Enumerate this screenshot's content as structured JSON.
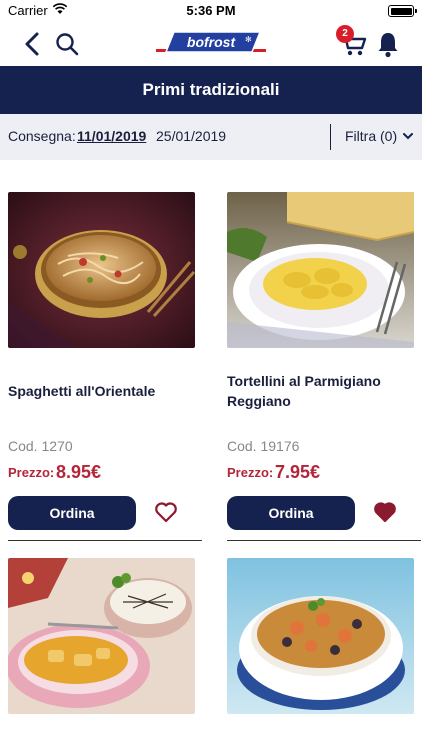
{
  "status_bar": {
    "carrier": "Carrier",
    "time": "5:36 PM"
  },
  "header": {
    "logo_text": "bofrost",
    "cart_count": "2"
  },
  "page_title": "Primi tradizionali",
  "delivery": {
    "label": "Consegna:",
    "dates": [
      "11/01/2019",
      "25/01/2019"
    ],
    "selected_date": "11/01/2019",
    "filter_label": "Filtra (0)"
  },
  "products": [
    {
      "name": "Spaghetti all'Orientale",
      "code": "Cod. 1270",
      "price_label": "Prezzo:",
      "price": "8.95€",
      "order_label": "Ordina",
      "favorite": false
    },
    {
      "name": "Tortellini al Parmigiano Reggiano",
      "code": "Cod. 19176",
      "price_label": "Prezzo:",
      "price": "7.95€",
      "order_label": "Ordina",
      "favorite": true
    },
    {
      "name": "",
      "code": "",
      "price_label": "",
      "price": "",
      "order_label": "",
      "favorite": false
    },
    {
      "name": "",
      "code": "",
      "price_label": "",
      "price": "",
      "order_label": "",
      "favorite": false
    }
  ],
  "colors": {
    "brand_navy": "#15224f",
    "price_red": "#b3263a",
    "badge_red": "#d81e2a",
    "filter_bg": "#eeeff4"
  }
}
